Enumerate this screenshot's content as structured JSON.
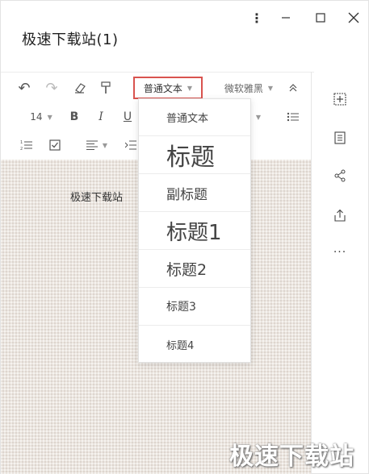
{
  "window": {
    "title": "极速下载站(1)"
  },
  "toolbar": {
    "undo": "↶",
    "redo": "↷",
    "paragraph_style": "普通文本",
    "font_family": "微软雅黑",
    "font_size": "14",
    "bold": "B",
    "italic": "I",
    "underline": "U"
  },
  "document": {
    "text": "极速下载站"
  },
  "style_menu": {
    "items": [
      {
        "label": "普通文本"
      },
      {
        "label": "标题"
      },
      {
        "label": "副标题"
      },
      {
        "label": "标题1"
      },
      {
        "label": "标题2"
      },
      {
        "label": "标题3"
      },
      {
        "label": "标题4"
      }
    ]
  },
  "sidebar": {
    "icons": [
      "add-box-icon",
      "document-icon",
      "share-icon",
      "export-icon",
      "more-icon"
    ],
    "more": "···"
  },
  "watermark": "极速下载站",
  "colors": {
    "highlight_border": "#d9534f",
    "paper": "#ece6e0"
  }
}
